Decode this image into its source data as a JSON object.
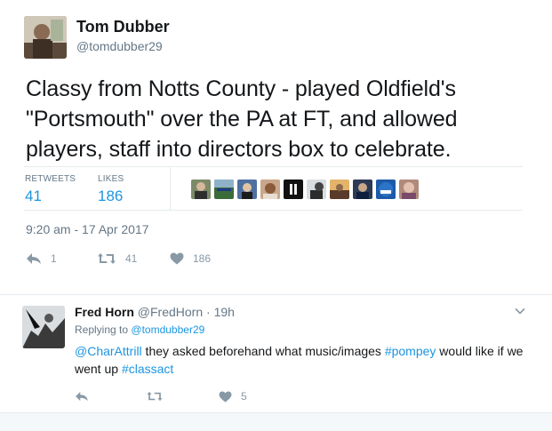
{
  "main_tweet": {
    "author_name": "Tom Dubber",
    "author_handle": "@tomdubber29",
    "text": "Classy from Notts County - played Oldfield's \"Portsmouth\" over the PA at FT, and allowed players, staff into directors box to celebrate.",
    "stats": {
      "retweets_label": "RETWEETS",
      "retweets_value": "41",
      "likes_label": "LIKES",
      "likes_value": "186"
    },
    "likers": [
      {
        "icon": "liker-avatar-1",
        "color": "#7d8a6a"
      },
      {
        "icon": "liker-avatar-2",
        "color": "#3c6b3a"
      },
      {
        "icon": "liker-avatar-3",
        "color": "#4f6fa0"
      },
      {
        "icon": "liker-avatar-4",
        "color": "#c9a78a"
      },
      {
        "icon": "liker-avatar-5",
        "color": "#111111"
      },
      {
        "icon": "liker-avatar-6",
        "color": "#2b2b2b"
      },
      {
        "icon": "liker-avatar-7",
        "color": "#8a6a4a"
      },
      {
        "icon": "liker-avatar-8",
        "color": "#2d3a55"
      },
      {
        "icon": "liker-avatar-9",
        "color": "#1d5aa8"
      },
      {
        "icon": "liker-avatar-10",
        "color": "#b08a7a"
      }
    ],
    "timestamp": "9:20 am - 17 Apr 2017",
    "actions": {
      "reply_count": "1",
      "retweet_count": "41",
      "like_count": "186"
    }
  },
  "reply_tweet": {
    "author_name": "Fred Horn",
    "author_handle": "@FredHorn",
    "separator": "·",
    "time": "19h",
    "replying_to_label": "Replying to",
    "replying_to_handle": "@tomdubber29",
    "text_parts": {
      "mention": "@CharAttrill",
      "text_1": " they asked beforehand what music/images ",
      "hashtag_1": "#pompey",
      "text_2": " would like if we went up ",
      "hashtag_2": "#classact"
    },
    "actions": {
      "reply_count": "",
      "retweet_count": "",
      "like_count": "5"
    }
  },
  "colors": {
    "link": "#1b95e0",
    "muted": "#657786",
    "icon": "#8899a6",
    "border": "#e6ecf0"
  }
}
